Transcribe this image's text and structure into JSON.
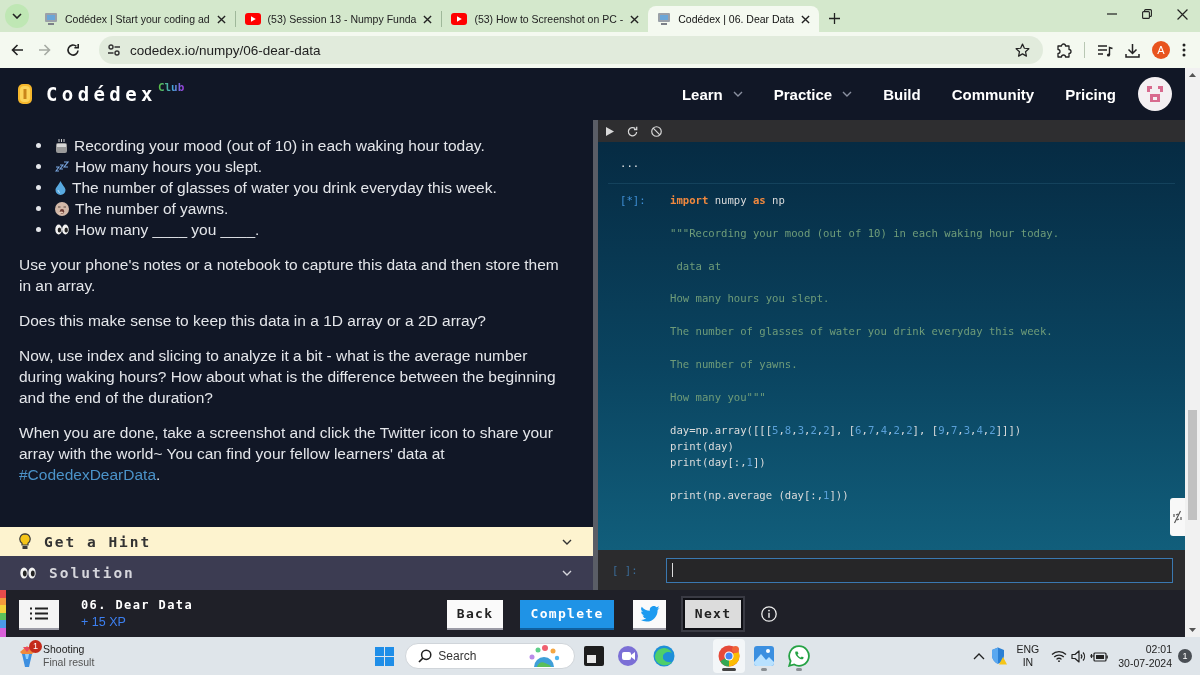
{
  "browser": {
    "tabs": [
      {
        "kind": "codedex",
        "title": "Codédex | Start your coding ad",
        "selected": false
      },
      {
        "kind": "youtube",
        "title": "(53) Session 13 - Numpy Funda",
        "selected": false
      },
      {
        "kind": "youtube",
        "title": "(53) How to Screenshot on PC -",
        "selected": false
      },
      {
        "kind": "codedex",
        "title": "Codédex | 06. Dear Data",
        "selected": true
      }
    ],
    "nav_buttons": [
      {
        "kind": "back",
        "disabled": false
      },
      {
        "kind": "forward",
        "disabled": true
      },
      {
        "kind": "reload",
        "disabled": false
      }
    ],
    "url": "codedex.io/numpy/06-dear-data",
    "profile_initial": "A"
  },
  "site_header": {
    "logo": "Codédex",
    "logo_badge": "Club",
    "nav": [
      {
        "label": "Learn",
        "dropdown": true
      },
      {
        "label": "Practice",
        "dropdown": true
      },
      {
        "label": "Build",
        "dropdown": false
      },
      {
        "label": "Community",
        "dropdown": false
      },
      {
        "label": "Pricing",
        "dropdown": false
      }
    ]
  },
  "lesson": {
    "bullets": [
      {
        "kind": "mug",
        "text": "Recording your mood (out of 10) in each waking hour today."
      },
      {
        "kind": "zzz",
        "text": "How many hours you slept."
      },
      {
        "kind": "droplet",
        "text": "The number of glasses of water you drink everyday this week."
      },
      {
        "kind": "yawn",
        "text": "The number of yawns."
      },
      {
        "kind": "eyes",
        "text": "How many ____ you ____."
      }
    ],
    "paragraphs": [
      {
        "text": "Use your phone's notes or a notebook to capture this data and then store them in an array."
      },
      {
        "text": "Does this make sense to keep this data in a 1D array or a 2D array?"
      },
      {
        "text": "Now, use index and slicing to analyze it a bit - what is the average number during waking hours? How about what is the difference between the beginning and the end of the duration?"
      },
      {
        "text": "When you are done, take a screenshot and click the Twitter icon to share your array with the world~ You can find your fellow learners' data at ",
        "link": "#CodedexDearData",
        "after": "."
      }
    ]
  },
  "accordions": [
    {
      "kind": "hint",
      "label": "Get a Hint",
      "expanded": false
    },
    {
      "kind": "solution",
      "label": "Solution",
      "expanded": false
    }
  ],
  "notebook": {
    "output": "...",
    "cells": [
      {
        "prompt": "[*]:",
        "blocks": [
          [
            [
              {
                "kind": "keyword",
                "text": "import"
              },
              {
                "kind": "plain",
                "text": " numpy "
              },
              {
                "kind": "keyword",
                "text": "as"
              },
              {
                "kind": "plain",
                "text": " np"
              }
            ]
          ],
          [
            [
              {
                "kind": "string",
                "text": "\"\"\"Recording your mood (out of 10) in each waking hour today."
              }
            ]
          ],
          [
            [
              {
                "kind": "string",
                "text": " data at"
              }
            ]
          ],
          [
            [
              {
                "kind": "string",
                "text": "How many hours you slept."
              }
            ]
          ],
          [
            [
              {
                "kind": "string",
                "text": "The number of glasses of water you drink everyday this week."
              }
            ]
          ],
          [
            [
              {
                "kind": "string",
                "text": "The number of yawns."
              }
            ]
          ],
          [
            [
              {
                "kind": "string",
                "text": "How many you\"\"\""
              }
            ]
          ],
          [
            [
              {
                "kind": "plain",
                "text": "day=np.array([[["
              },
              {
                "kind": "number",
                "text": "5"
              },
              {
                "kind": "plain",
                "text": ","
              },
              {
                "kind": "number",
                "text": "8"
              },
              {
                "kind": "plain",
                "text": ","
              },
              {
                "kind": "number",
                "text": "3"
              },
              {
                "kind": "plain",
                "text": ","
              },
              {
                "kind": "number",
                "text": "2"
              },
              {
                "kind": "plain",
                "text": ","
              },
              {
                "kind": "number",
                "text": "2"
              },
              {
                "kind": "plain",
                "text": "], ["
              },
              {
                "kind": "number",
                "text": "6"
              },
              {
                "kind": "plain",
                "text": ","
              },
              {
                "kind": "number",
                "text": "7"
              },
              {
                "kind": "plain",
                "text": ","
              },
              {
                "kind": "number",
                "text": "4"
              },
              {
                "kind": "plain",
                "text": ","
              },
              {
                "kind": "number",
                "text": "2"
              },
              {
                "kind": "plain",
                "text": ","
              },
              {
                "kind": "number",
                "text": "2"
              },
              {
                "kind": "plain",
                "text": "], ["
              },
              {
                "kind": "number",
                "text": "9"
              },
              {
                "kind": "plain",
                "text": ","
              },
              {
                "kind": "number",
                "text": "7"
              },
              {
                "kind": "plain",
                "text": ","
              },
              {
                "kind": "number",
                "text": "3"
              },
              {
                "kind": "plain",
                "text": ","
              },
              {
                "kind": "number",
                "text": "4"
              },
              {
                "kind": "plain",
                "text": ","
              },
              {
                "kind": "number",
                "text": "2"
              },
              {
                "kind": "plain",
                "text": "]]])"
              }
            ],
            [
              {
                "kind": "plain",
                "text": "print(day)"
              }
            ],
            [
              {
                "kind": "plain",
                "text": "print(day[:,"
              },
              {
                "kind": "number",
                "text": "1"
              },
              {
                "kind": "plain",
                "text": "])"
              }
            ]
          ],
          [
            [
              {
                "kind": "plain",
                "text": "print(np.average (day[:,"
              },
              {
                "kind": "number",
                "text": "1"
              },
              {
                "kind": "plain",
                "text": "]))"
              }
            ]
          ]
        ]
      }
    ],
    "input_prompt": "[ ]:"
  },
  "lesson_bar": {
    "title": "06. Dear Data",
    "xp": "+ 15 XP",
    "buttons": [
      {
        "kind": "back",
        "label": "Back"
      },
      {
        "kind": "complete",
        "label": "Complete"
      },
      {
        "kind": "twitter"
      },
      {
        "kind": "next",
        "label": "Next"
      }
    ]
  },
  "taskbar": {
    "widget": {
      "title": "Shooting",
      "subtitle": "Final result",
      "badge": "1"
    },
    "search": {
      "placeholder": "Search"
    },
    "apps": [
      {
        "kind": "tile",
        "selected": false,
        "running": false
      },
      {
        "kind": "video",
        "selected": false,
        "running": false
      },
      {
        "kind": "swirl",
        "selected": false,
        "running": false
      },
      {
        "kind": "browser",
        "selected": true,
        "running": true
      },
      {
        "kind": "photos",
        "selected": false,
        "running": true
      },
      {
        "kind": "chat",
        "selected": false,
        "running": true
      }
    ],
    "language": "ENG",
    "region": "IN",
    "time": "02:01",
    "date": "30-07-2024",
    "notifications": "1"
  }
}
